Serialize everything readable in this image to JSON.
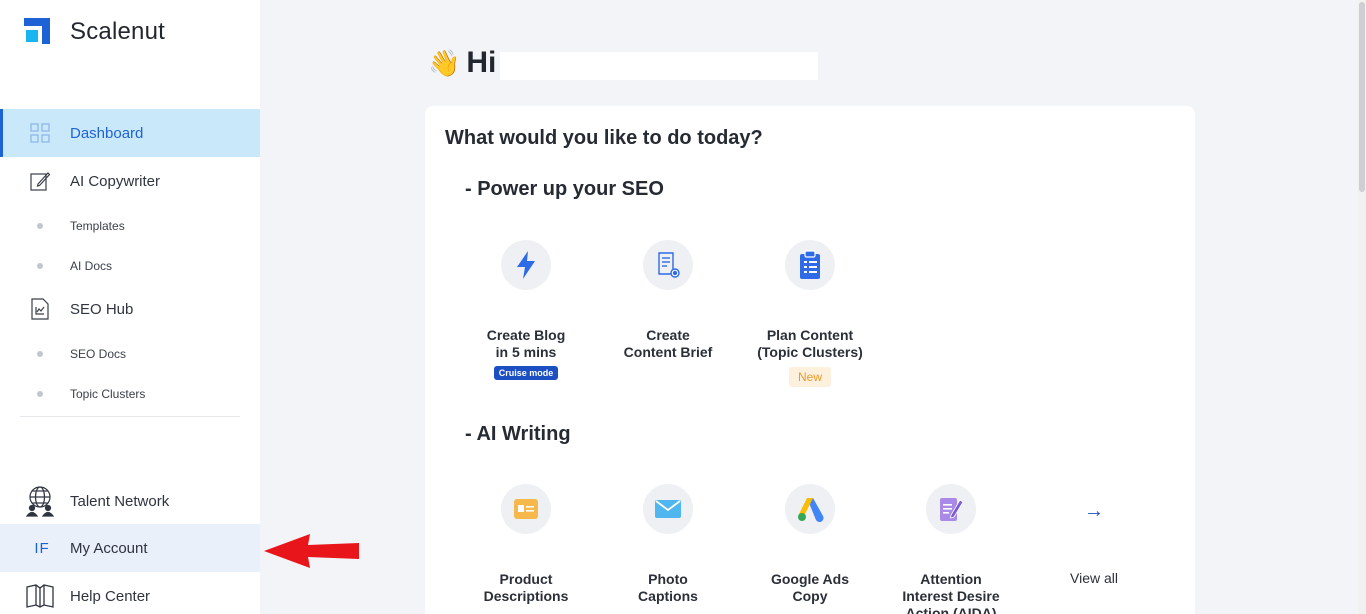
{
  "brand": {
    "name": "Scalenut"
  },
  "sidebar": {
    "dashboard": "Dashboard",
    "ai_copywriter": "AI Copywriter",
    "templates": "Templates",
    "ai_docs": "AI Docs",
    "seo_hub": "SEO Hub",
    "seo_docs": "SEO Docs",
    "topic_clusters": "Topic Clusters",
    "talent_network": "Talent Network",
    "account_initials": "IF",
    "my_account": "My Account",
    "help_center": "Help Center"
  },
  "main": {
    "greeting": "Hi",
    "prompt": "What would you like to do today?",
    "seo_section": "- Power up your SEO",
    "seo_tiles": [
      {
        "title_line1": "Create Blog",
        "title_line2": "in 5 mins",
        "badge": "Cruise mode"
      },
      {
        "title_line1": "Create",
        "title_line2": "Content Brief"
      },
      {
        "title_line1": "Plan Content",
        "title_line2": "(Topic Clusters)",
        "badge": "New"
      }
    ],
    "ai_section": "- AI Writing",
    "ai_tiles": [
      {
        "title_line1": "Product",
        "title_line2": "Descriptions"
      },
      {
        "title_line1": "Photo",
        "title_line2": "Captions"
      },
      {
        "title_line1": "Google Ads",
        "title_line2": "Copy"
      },
      {
        "title_line1": "Attention",
        "title_line2": "Interest Desire",
        "title_line3": "Action (AIDA)"
      }
    ],
    "view_all": "View all"
  },
  "colors": {
    "accent": "#1e63d6",
    "active_bg": "#c9e9fb",
    "badge_blue": "#1c4fc2",
    "badge_new": "#e99a2c"
  }
}
